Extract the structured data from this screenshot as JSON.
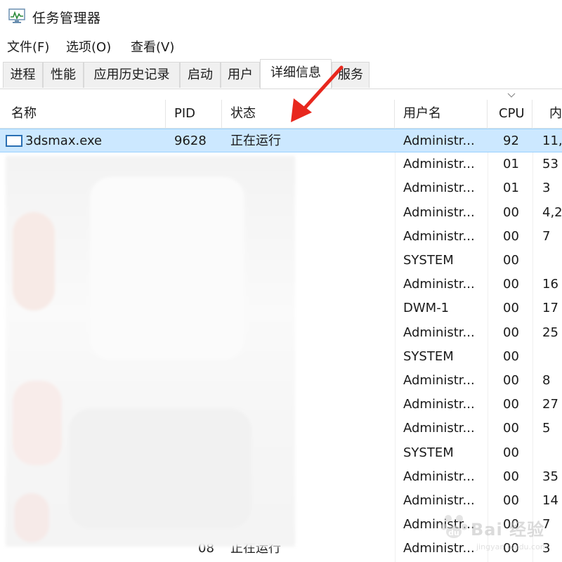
{
  "window": {
    "title": "任务管理器"
  },
  "menu": {
    "file": "文件(F)",
    "options": "选项(O)",
    "view": "查看(V)"
  },
  "tabs": [
    {
      "label": "进程"
    },
    {
      "label": "性能"
    },
    {
      "label": "应用历史记录"
    },
    {
      "label": "启动"
    },
    {
      "label": "用户"
    },
    {
      "label": "详细信息",
      "active": true
    },
    {
      "label": "服务"
    }
  ],
  "columns": {
    "name": "名称",
    "pid": "PID",
    "status": "状态",
    "user": "用户名",
    "cpu": "CPU",
    "memory": "内"
  },
  "rows": [
    {
      "name": "3dsmax.exe",
      "pid": "9628",
      "status": "正在运行",
      "user": "Administr...",
      "cpu": "92",
      "memory": "11,",
      "selected": true
    },
    {
      "name": "",
      "pid": "",
      "status": "",
      "user": "Administr...",
      "cpu": "01",
      "memory": "53"
    },
    {
      "name": "",
      "pid": "",
      "status": "",
      "user": "Administr...",
      "cpu": "01",
      "memory": "3"
    },
    {
      "name": "",
      "pid": "",
      "status": "",
      "user": "Administr...",
      "cpu": "00",
      "memory": "4,2"
    },
    {
      "name": "",
      "pid": "",
      "status": "",
      "user": "Administr...",
      "cpu": "00",
      "memory": "7"
    },
    {
      "name": "",
      "pid": "",
      "status": "",
      "user": "SYSTEM",
      "cpu": "00",
      "memory": ""
    },
    {
      "name": "",
      "pid": "",
      "status": "",
      "user": "Administr...",
      "cpu": "00",
      "memory": "16"
    },
    {
      "name": "",
      "pid": "",
      "status": "",
      "user": "DWM-1",
      "cpu": "00",
      "memory": "17"
    },
    {
      "name": "",
      "pid": "",
      "status": "",
      "user": "Administr...",
      "cpu": "00",
      "memory": "25"
    },
    {
      "name": "",
      "pid": "",
      "status": "",
      "user": "SYSTEM",
      "cpu": "00",
      "memory": ""
    },
    {
      "name": "",
      "pid": "",
      "status": "",
      "user": "Administr...",
      "cpu": "00",
      "memory": "8"
    },
    {
      "name": "",
      "pid": "",
      "status": "",
      "user": "Administr...",
      "cpu": "00",
      "memory": "27"
    },
    {
      "name": "",
      "pid": "",
      "status": "",
      "user": "Administr...",
      "cpu": "00",
      "memory": "5"
    },
    {
      "name": "",
      "pid": "",
      "status": "",
      "user": "SYSTEM",
      "cpu": "00",
      "memory": ""
    },
    {
      "name": "",
      "pid": "",
      "status": "",
      "user": "Administr...",
      "cpu": "00",
      "memory": "35"
    },
    {
      "name": "",
      "pid": "",
      "status": "",
      "user": "Administr...",
      "cpu": "00",
      "memory": "14"
    },
    {
      "name": "",
      "pid": "",
      "status": "",
      "user": "Administr...",
      "cpu": "00",
      "memory": "7"
    },
    {
      "name": "",
      "pid": "08",
      "status": "正在运行",
      "user": "Administr...",
      "cpu": "00",
      "memory": "3"
    }
  ],
  "watermark": {
    "text": "Bai 经验",
    "url": "jingyan.baidu.com"
  },
  "colors": {
    "selection": "#cce8ff",
    "arrow": "#e8281e",
    "icon_blue": "#2a6fb3"
  }
}
